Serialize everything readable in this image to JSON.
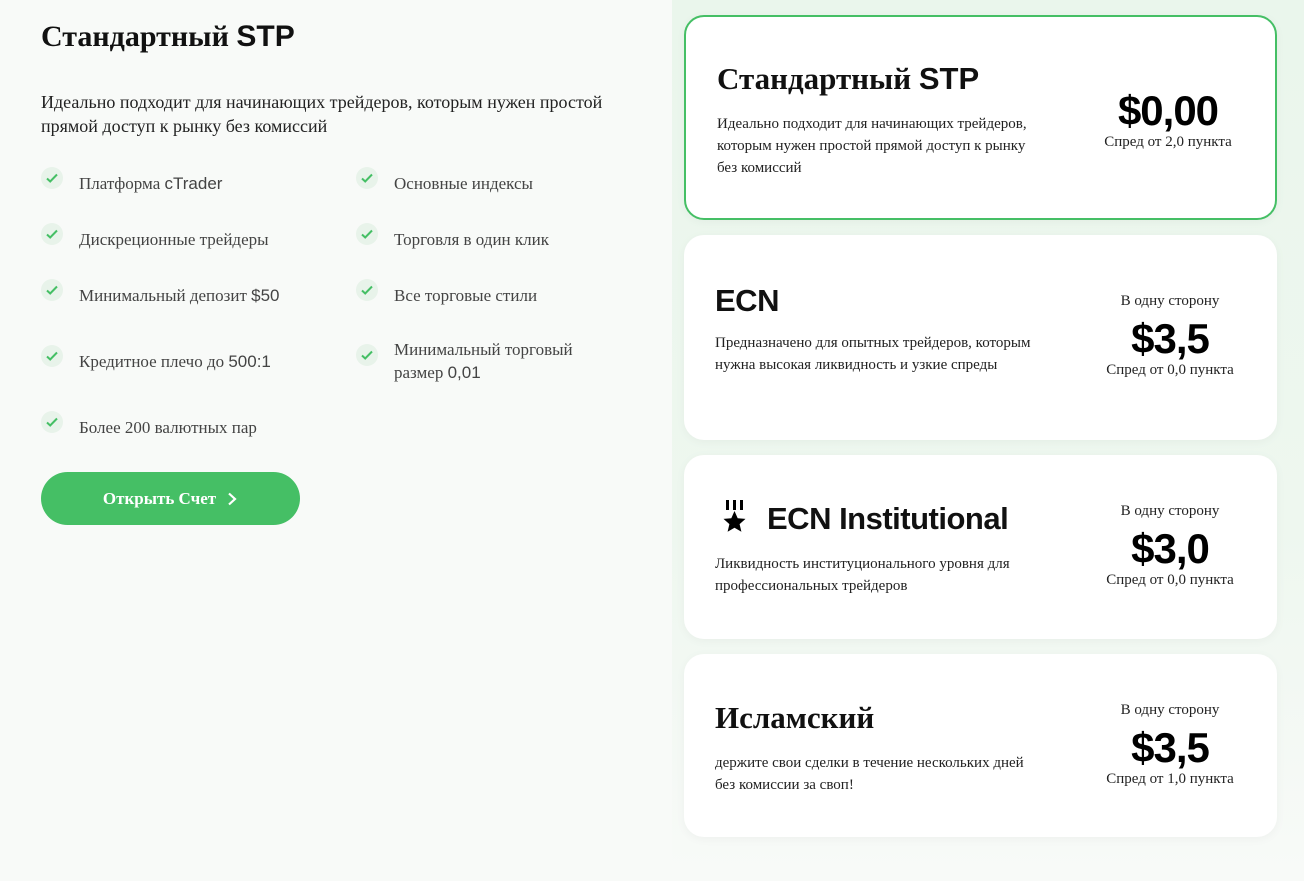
{
  "left": {
    "title_main": "Стандартный ",
    "title_stp": "STP",
    "description": "Идеально подходит для начинающих трейдеров, которым нужен простой прямой доступ к рынку без комиссий",
    "features": [
      {
        "label_a": "Платформа ",
        "label_b": "cTrader"
      },
      {
        "label_a": "Основные индексы",
        "label_b": ""
      },
      {
        "label_a": "Дискреционные трейдеры",
        "label_b": ""
      },
      {
        "label_a": "Торговля в один клик",
        "label_b": ""
      },
      {
        "label_a": "Минимальный депозит ",
        "label_b": "$50"
      },
      {
        "label_a": "Все торговые стили",
        "label_b": ""
      },
      {
        "label_a": "Кредитное плечо до ",
        "label_b": "500:1"
      },
      {
        "label_a": "Минимальный торговый размер ",
        "label_b": "0,01"
      },
      {
        "label_a": "Более 200 валютных пар",
        "label_b": ""
      }
    ],
    "open_button": "Открыть Счет"
  },
  "accounts": [
    {
      "title_a": "Стандартный ",
      "title_b": "STP",
      "description": "Идеально подходит для начинающих трейдеров, которым нужен простой прямой доступ к рынку без комиссий",
      "side": "",
      "price": "$0,00",
      "spread": "Спред от 2,0 пункта",
      "selected": true
    },
    {
      "title_a": "",
      "title_b": "ECN",
      "description": "Предназначено для опытных трейдеров, которым нужна высокая ликвидность и узкие спреды",
      "side": "В одну сторону",
      "price": "$3,5",
      "spread": "Спред от 0,0 пункта",
      "selected": false
    },
    {
      "title_a": "",
      "title_b": "ECN Institutional",
      "description": "Ликвидность институционального уровня для профессиональных трейдеров",
      "side": "В одну сторону",
      "price": "$3,0",
      "spread": "Спред от 0,0 пункта",
      "selected": false
    },
    {
      "title_a": "Исламский",
      "title_b": "",
      "description": "держите свои сделки в течение нескольких дней без комиссии за своп!",
      "side": "В одну сторону",
      "price": "$3,5",
      "spread": "Спред от 1,0 пункта",
      "selected": false
    }
  ],
  "colors": {
    "accent": "#45bf65",
    "check_bg": "#e8f3ea"
  },
  "icons": {
    "feature": "check-icon",
    "button": "chevron-right-icon",
    "institutional": "medal-star-icon"
  }
}
